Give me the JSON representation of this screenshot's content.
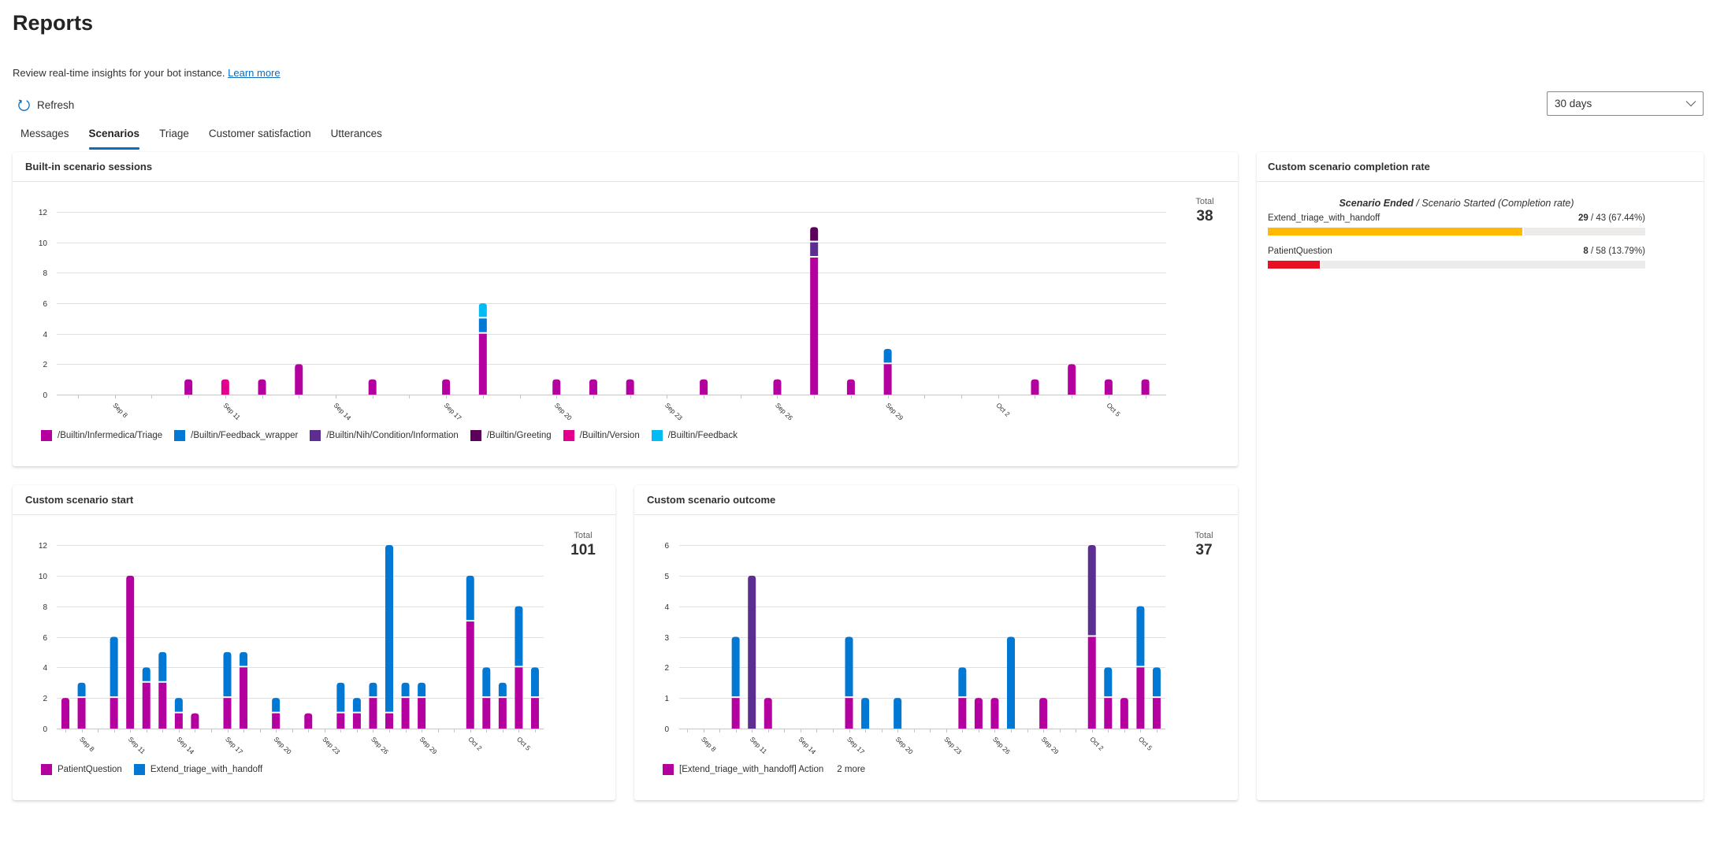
{
  "page": {
    "title": "Reports",
    "subtitle": "Review real-time insights for your bot instance.",
    "learn_more": "Learn more"
  },
  "toolbar": {
    "refresh_label": "Refresh",
    "refresh_icon": "refresh-icon",
    "range_selected": "30 days",
    "range_icon": "chevron-down-icon"
  },
  "tabs": [
    {
      "label": "Messages",
      "active": false
    },
    {
      "label": "Scenarios",
      "active": true
    },
    {
      "label": "Triage",
      "active": false
    },
    {
      "label": "Customer satisfaction",
      "active": false
    },
    {
      "label": "Utterances",
      "active": false
    }
  ],
  "cards": {
    "builtin": {
      "title": "Built-in scenario sessions",
      "total_label": "Total",
      "total_value": "38"
    },
    "start": {
      "title": "Custom scenario start",
      "total_label": "Total",
      "total_value": "101"
    },
    "outcome": {
      "title": "Custom scenario outcome",
      "total_label": "Total",
      "total_value": "37",
      "legend_more": "2 more"
    },
    "completion": {
      "title": "Custom scenario completion rate",
      "heading_bold": "Scenario Ended",
      "heading_rest": " / Scenario Started (Completion rate)",
      "rows": [
        {
          "name": "Extend_triage_with_handoff",
          "ended": 29,
          "started": 43,
          "rate": "67.44%",
          "fraction": 0.6744,
          "color": "#ffb900"
        },
        {
          "name": "PatientQuestion",
          "ended": 8,
          "started": 58,
          "rate": "13.79%",
          "fraction": 0.1379,
          "color": "#e81123"
        }
      ]
    }
  },
  "chart_data": [
    {
      "type": "bar",
      "stacked": true,
      "title": "Built-in scenario sessions",
      "xlabel": "",
      "ylabel": "",
      "ylim": [
        0,
        12
      ],
      "yticks": [
        0,
        2,
        4,
        6,
        8,
        10,
        12
      ],
      "grid": true,
      "legend": "bottom-left",
      "total": 38,
      "x": [
        "Sep 7",
        "Sep 8",
        "Sep 9",
        "Sep 10",
        "Sep 11",
        "Sep 12",
        "Sep 13",
        "Sep 14",
        "Sep 15",
        "Sep 16",
        "Sep 17",
        "Sep 18",
        "Sep 19",
        "Sep 20",
        "Sep 21",
        "Sep 22",
        "Sep 23",
        "Sep 24",
        "Sep 25",
        "Sep 26",
        "Sep 27",
        "Sep 28",
        "Sep 29",
        "Sep 30",
        "Oct 1",
        "Oct 2",
        "Oct 3",
        "Oct 4",
        "Oct 5",
        "Oct 6"
      ],
      "xtick_labels": [
        "Sep 8",
        "Sep 11",
        "Sep 14",
        "Sep 17",
        "Sep 20",
        "Sep 23",
        "Sep 26",
        "Sep 29",
        "Oct 2",
        "Oct 5"
      ],
      "series": [
        {
          "name": "/Builtin/Infermedica/Triage",
          "color": "#b4009e",
          "values": [
            0,
            0,
            0,
            1,
            0,
            1,
            2,
            0,
            1,
            0,
            1,
            4,
            0,
            1,
            1,
            1,
            0,
            1,
            0,
            1,
            9,
            1,
            2,
            0,
            0,
            0,
            1,
            2,
            1,
            1
          ]
        },
        {
          "name": "/Builtin/Feedback_wrapper",
          "color": "#0078d4",
          "values": [
            0,
            0,
            0,
            0,
            0,
            0,
            0,
            0,
            0,
            0,
            0,
            1,
            0,
            0,
            0,
            0,
            0,
            0,
            0,
            0,
            0,
            0,
            1,
            0,
            0,
            0,
            0,
            0,
            0,
            0
          ]
        },
        {
          "name": "/Builtin/Nih/Condition/Information",
          "color": "#5c2e91",
          "values": [
            0,
            0,
            0,
            0,
            0,
            0,
            0,
            0,
            0,
            0,
            0,
            0,
            0,
            0,
            0,
            0,
            0,
            0,
            0,
            0,
            1,
            0,
            0,
            0,
            0,
            0,
            0,
            0,
            0,
            0
          ]
        },
        {
          "name": "/Builtin/Greeting",
          "color": "#5c005c",
          "values": [
            0,
            0,
            0,
            0,
            0,
            0,
            0,
            0,
            0,
            0,
            0,
            0,
            0,
            0,
            0,
            0,
            0,
            0,
            0,
            0,
            1,
            0,
            0,
            0,
            0,
            0,
            0,
            0,
            0,
            0
          ]
        },
        {
          "name": "/Builtin/Version",
          "color": "#e3008c",
          "values": [
            0,
            0,
            0,
            0,
            1,
            0,
            0,
            0,
            0,
            0,
            0,
            0,
            0,
            0,
            0,
            0,
            0,
            0,
            0,
            0,
            0,
            0,
            0,
            0,
            0,
            0,
            0,
            0,
            0,
            0
          ]
        },
        {
          "name": "/Builtin/Feedback",
          "color": "#00bcf2",
          "values": [
            0,
            0,
            0,
            0,
            0,
            0,
            0,
            0,
            0,
            0,
            0,
            1,
            0,
            0,
            0,
            0,
            0,
            0,
            0,
            0,
            0,
            0,
            0,
            0,
            0,
            0,
            0,
            0,
            0,
            0
          ]
        }
      ]
    },
    {
      "type": "bar",
      "stacked": true,
      "title": "Custom scenario start",
      "xlabel": "",
      "ylabel": "",
      "ylim": [
        0,
        12
      ],
      "yticks": [
        0,
        2,
        4,
        6,
        8,
        10,
        12
      ],
      "grid": true,
      "legend": "bottom-left",
      "total": 101,
      "x": [
        "Sep 7",
        "Sep 8",
        "Sep 9",
        "Sep 10",
        "Sep 11",
        "Sep 12",
        "Sep 13",
        "Sep 14",
        "Sep 15",
        "Sep 16",
        "Sep 17",
        "Sep 18",
        "Sep 19",
        "Sep 20",
        "Sep 21",
        "Sep 22",
        "Sep 23",
        "Sep 24",
        "Sep 25",
        "Sep 26",
        "Sep 27",
        "Sep 28",
        "Sep 29",
        "Sep 30",
        "Oct 1",
        "Oct 2",
        "Oct 3",
        "Oct 4",
        "Oct 5",
        "Oct 6"
      ],
      "xtick_labels": [
        "Sep 8",
        "Sep 11",
        "Sep 14",
        "Sep 17",
        "Sep 20",
        "Sep 23",
        "Sep 26",
        "Sep 29",
        "Oct 2",
        "Oct 5"
      ],
      "series": [
        {
          "name": "PatientQuestion",
          "color": "#b4009e",
          "values": [
            2,
            2,
            0,
            2,
            10,
            3,
            3,
            1,
            1,
            0,
            2,
            4,
            0,
            1,
            0,
            1,
            0,
            1,
            1,
            2,
            1,
            2,
            2,
            0,
            0,
            7,
            2,
            2,
            4,
            2
          ]
        },
        {
          "name": "Extend_triage_with_handoff",
          "color": "#0078d4",
          "values": [
            0,
            1,
            0,
            4,
            0,
            1,
            2,
            1,
            0,
            0,
            3,
            1,
            0,
            1,
            0,
            0,
            0,
            2,
            1,
            1,
            11,
            1,
            1,
            0,
            0,
            3,
            2,
            1,
            4,
            2
          ]
        }
      ]
    },
    {
      "type": "bar",
      "stacked": true,
      "title": "Custom scenario outcome",
      "xlabel": "",
      "ylabel": "",
      "ylim": [
        0,
        6
      ],
      "yticks": [
        0,
        1,
        2,
        3,
        4,
        5,
        6
      ],
      "grid": true,
      "legend": "bottom-left",
      "total": 37,
      "x": [
        "Sep 7",
        "Sep 8",
        "Sep 9",
        "Sep 10",
        "Sep 11",
        "Sep 12",
        "Sep 13",
        "Sep 14",
        "Sep 15",
        "Sep 16",
        "Sep 17",
        "Sep 18",
        "Sep 19",
        "Sep 20",
        "Sep 21",
        "Sep 22",
        "Sep 23",
        "Sep 24",
        "Sep 25",
        "Sep 26",
        "Sep 27",
        "Sep 28",
        "Sep 29",
        "Sep 30",
        "Oct 1",
        "Oct 2",
        "Oct 3",
        "Oct 4",
        "Oct 5",
        "Oct 6"
      ],
      "xtick_labels": [
        "Sep 8",
        "Sep 11",
        "Sep 14",
        "Sep 17",
        "Sep 20",
        "Sep 23",
        "Sep 26",
        "Sep 29",
        "Oct 2",
        "Oct 5"
      ],
      "series": [
        {
          "name": "[Extend_triage_with_handoff] Action",
          "color": "#b4009e",
          "legend_visible": true,
          "values": [
            0,
            0,
            0,
            1,
            0,
            1,
            0,
            0,
            0,
            0,
            1,
            0,
            0,
            0,
            0,
            0,
            0,
            1,
            1,
            1,
            0,
            0,
            1,
            0,
            0,
            3,
            1,
            1,
            2,
            1
          ]
        },
        {
          "name": null,
          "color": "#0078d4",
          "legend_visible": false,
          "values": [
            0,
            0,
            0,
            2,
            0,
            0,
            0,
            0,
            0,
            0,
            2,
            1,
            0,
            1,
            0,
            0,
            0,
            1,
            0,
            0,
            3,
            0,
            0,
            0,
            0,
            0,
            1,
            0,
            2,
            1
          ]
        },
        {
          "name": null,
          "color": "#5c2e91",
          "legend_visible": false,
          "values": [
            0,
            0,
            0,
            0,
            5,
            0,
            0,
            0,
            0,
            0,
            0,
            0,
            0,
            0,
            0,
            0,
            0,
            0,
            0,
            0,
            0,
            0,
            0,
            0,
            0,
            3,
            0,
            0,
            0,
            0
          ]
        }
      ]
    }
  ]
}
